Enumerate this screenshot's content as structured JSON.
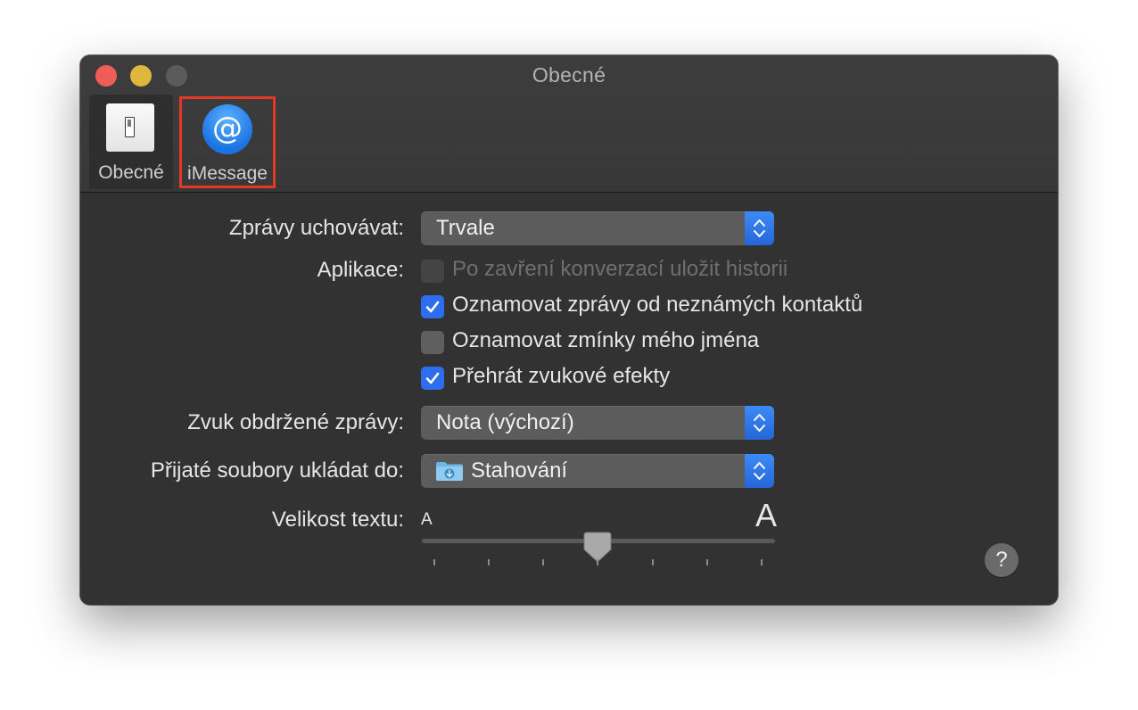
{
  "window": {
    "title": "Obecné"
  },
  "toolbar": {
    "items": [
      {
        "label": "Obecné",
        "icon": "switch-icon"
      },
      {
        "label": "iMessage",
        "icon": "at-icon",
        "highlighted": true
      }
    ],
    "at_glyph": "@"
  },
  "settings": {
    "keep_messages": {
      "label": "Zprávy uchovávat:",
      "value": "Trvale"
    },
    "application": {
      "label": "Aplikace:",
      "options": [
        {
          "label": "Po zavření konverzací uložit historii",
          "checked": false,
          "enabled": false
        },
        {
          "label": "Oznamovat zprávy od neznámých kontaktů",
          "checked": true,
          "enabled": true
        },
        {
          "label": "Oznamovat zmínky mého jména",
          "checked": false,
          "enabled": true
        },
        {
          "label": "Přehrát zvukové efekty",
          "checked": true,
          "enabled": true
        }
      ]
    },
    "message_sound": {
      "label": "Zvuk obdržené zprávy:",
      "value": "Nota (výchozí)"
    },
    "save_files": {
      "label": "Přijaté soubory ukládat do:",
      "value": "Stahování",
      "icon": "downloads-folder-icon"
    },
    "text_size": {
      "label": "Velikost textu:",
      "small_glyph": "A",
      "large_glyph": "A",
      "value_fraction": 0.5,
      "ticks": 7
    }
  },
  "help": {
    "glyph": "?"
  },
  "colors": {
    "accent": "#2d6ef0",
    "highlight_border": "#e23a26",
    "window_bg": "#323232"
  }
}
